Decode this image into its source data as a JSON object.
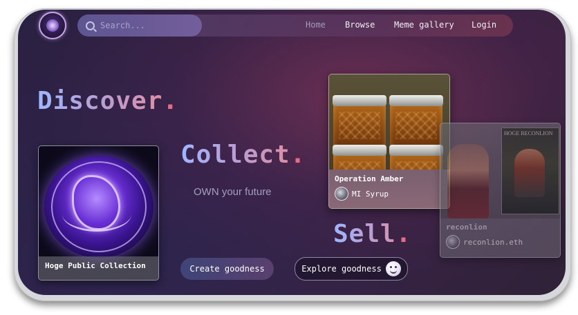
{
  "nav": {
    "search_placeholder": "Search...",
    "links": [
      {
        "label": "Home",
        "active": false
      },
      {
        "label": "Browse"
      },
      {
        "label": "Meme gallery"
      },
      {
        "label": "Login"
      }
    ]
  },
  "hero": {
    "discover": "Discover",
    "collect": "Collect",
    "sell": "Sell",
    "dot": ".",
    "tagline": "OWN your future",
    "create_button": "Create goodness",
    "explore_button": "Explore goodness"
  },
  "cards": {
    "hoge": {
      "title": "Hoge Public Collection"
    },
    "amber": {
      "title": "Operation Amber",
      "owner": "MI Syrup"
    },
    "recon": {
      "title": "reconlion",
      "owner": "reconlion.eth",
      "poster_text": "HOGE RECONLION"
    }
  },
  "colors": {
    "accent_dot": "#e56e85",
    "background": "#2e2240"
  },
  "icons": [
    "logo-icon",
    "search-icon",
    "smiley-icon"
  ]
}
